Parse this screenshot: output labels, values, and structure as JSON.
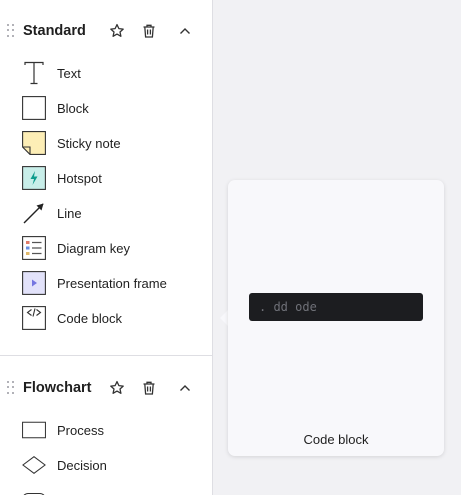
{
  "sections": [
    {
      "title": "Standard",
      "items": [
        {
          "label": "Text",
          "icon": "text-icon"
        },
        {
          "label": "Block",
          "icon": "block-icon"
        },
        {
          "label": "Sticky note",
          "icon": "sticky-note-icon"
        },
        {
          "label": "Hotspot",
          "icon": "hotspot-icon"
        },
        {
          "label": "Line",
          "icon": "line-icon"
        },
        {
          "label": "Diagram key",
          "icon": "diagram-key-icon"
        },
        {
          "label": "Presentation frame",
          "icon": "presentation-frame-icon"
        },
        {
          "label": "Code block",
          "icon": "code-block-icon"
        }
      ]
    },
    {
      "title": "Flowchart",
      "items": [
        {
          "label": "Process",
          "icon": "process-icon"
        },
        {
          "label": "Decision",
          "icon": "decision-icon"
        }
      ]
    }
  ],
  "preview": {
    "code_text": ".  dd  ode",
    "label": "Code block"
  },
  "colors": {
    "sticky_fill": "#fdeeb6",
    "hotspot_fill": "#c8eee9",
    "hotspot_bolt": "#0e9c8c",
    "frame_fill": "#e2e2fa",
    "frame_play": "#7475e0",
    "code_bg": "#1c1d20"
  }
}
